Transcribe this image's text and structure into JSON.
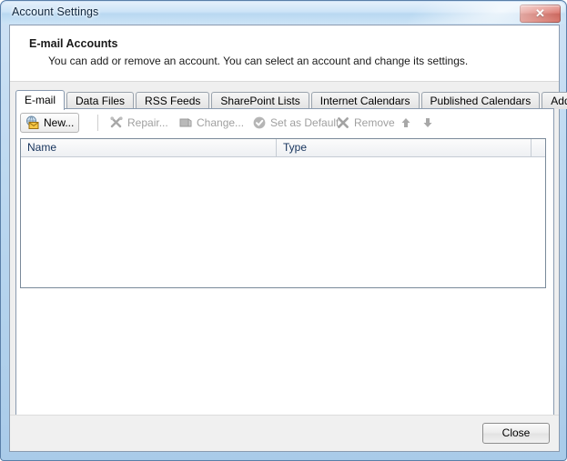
{
  "window": {
    "title": "Account Settings",
    "close_icon": "close-x-icon"
  },
  "header": {
    "title": "E-mail Accounts",
    "description": "You can add or remove an account. You can select an account and change its settings."
  },
  "tabs": [
    {
      "label": "E-mail",
      "active": true
    },
    {
      "label": "Data Files",
      "active": false
    },
    {
      "label": "RSS Feeds",
      "active": false
    },
    {
      "label": "SharePoint Lists",
      "active": false
    },
    {
      "label": "Internet Calendars",
      "active": false
    },
    {
      "label": "Published Calendars",
      "active": false
    },
    {
      "label": "Address Books",
      "active": false
    }
  ],
  "toolbar": [
    {
      "label": "New...",
      "icon": "new-mail-account-icon",
      "enabled": true
    },
    {
      "label": "Repair...",
      "icon": "repair-tools-icon",
      "enabled": false
    },
    {
      "label": "Change...",
      "icon": "change-account-icon",
      "enabled": false
    },
    {
      "label": "Set as Default",
      "icon": "set-default-check-icon",
      "enabled": false
    },
    {
      "label": "Remove",
      "icon": "remove-x-icon",
      "enabled": false
    },
    {
      "label": "",
      "icon": "move-up-arrow-icon",
      "enabled": false
    },
    {
      "label": "",
      "icon": "move-down-arrow-icon",
      "enabled": false
    }
  ],
  "accounts_list": {
    "columns": [
      "Name",
      "Type",
      ""
    ],
    "rows": []
  },
  "footer": {
    "close_label": "Close"
  },
  "colors": {
    "titlebar": "#cde4f7",
    "close_button": "#bb3c30",
    "panel": "#ffffff",
    "body": "#efefef",
    "column_header_text": "#16335c",
    "disabled_text": "#a0a0a0"
  }
}
